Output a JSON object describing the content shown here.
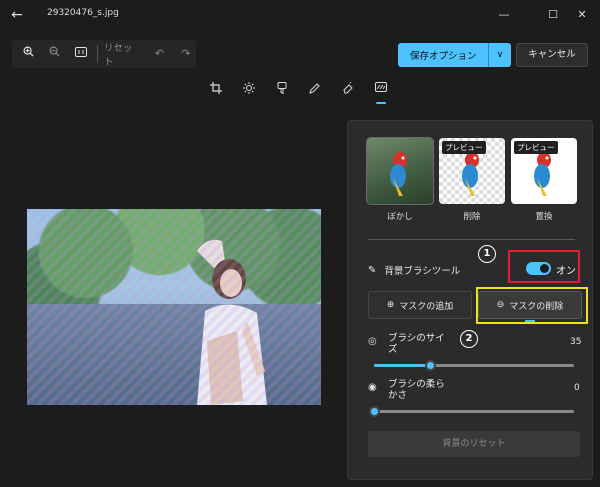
{
  "titlebar": {
    "filename": "29320476_s.jpg"
  },
  "zoom_toolbar": {
    "reset_label": "リセット"
  },
  "actions": {
    "save_label": "保存オプション",
    "cancel_label": "キャンセル"
  },
  "edit_tools": [
    "crop-icon",
    "brightness-icon",
    "filter-icon",
    "markup-icon",
    "eraser-icon",
    "background-icon"
  ],
  "background_options": [
    {
      "label": "ぼかし",
      "badge": ""
    },
    {
      "label": "削除",
      "badge": "プレビュー"
    },
    {
      "label": "置換",
      "badge": "プレビュー"
    }
  ],
  "brush_tool": {
    "title": "背景ブラシツール",
    "toggle_state": "オン"
  },
  "mask": {
    "add_label": "マスクの追加",
    "remove_label": "マスクの削除"
  },
  "annotations": {
    "marker1": "1",
    "marker2": "2"
  },
  "brush_size": {
    "label": "ブラシのサイズ",
    "value": "35",
    "level": 0.28
  },
  "brush_softness": {
    "label": "ブラシの柔らかさ",
    "value": "0",
    "level": 0.0
  },
  "reset_background_label": "背景のリセット",
  "colors": {
    "accent": "#4cc2ff",
    "highlight_red": "#e0202a",
    "highlight_yellow": "#f2e01a"
  }
}
